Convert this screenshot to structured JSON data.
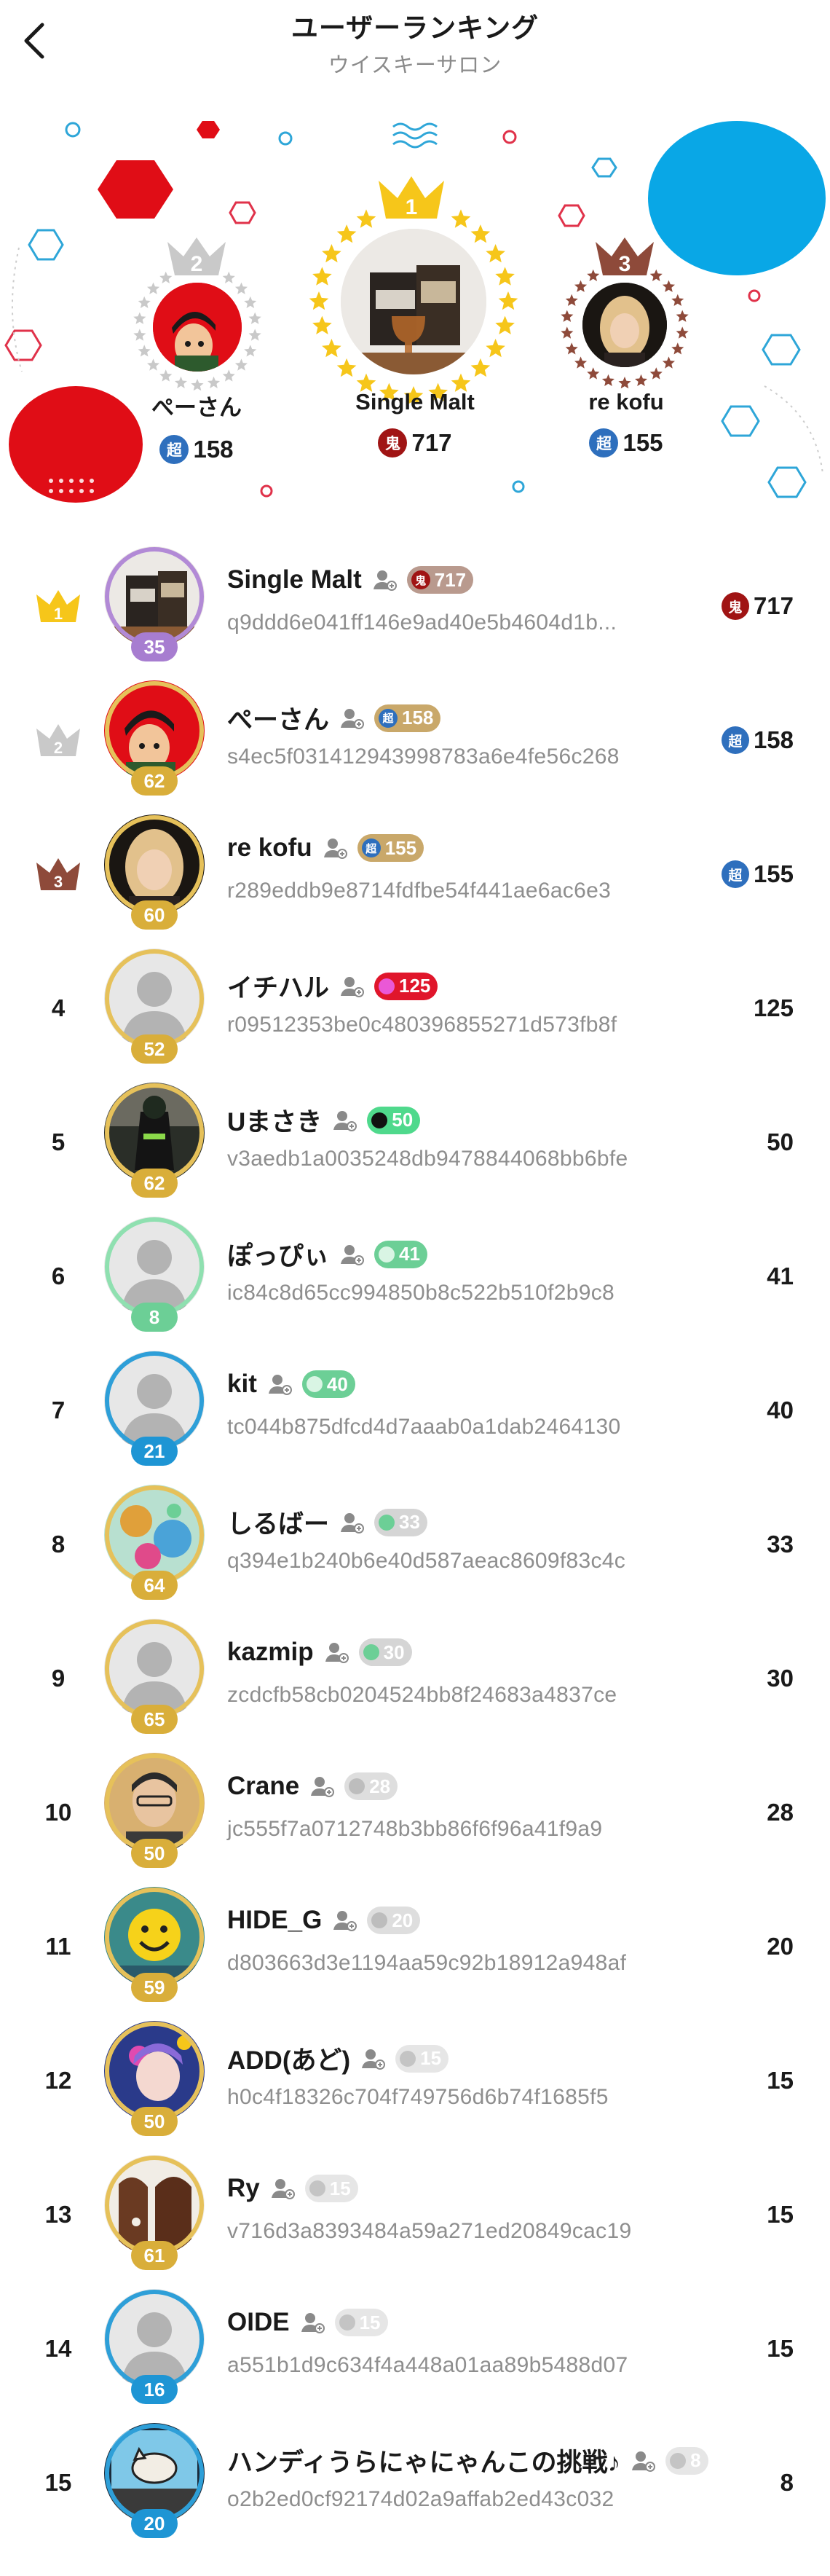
{
  "header": {
    "title": "ユーザーランキング",
    "subtitle": "ウイスキーサロン"
  },
  "podium": {
    "first": {
      "rank": "1",
      "name": "Single Malt",
      "badge": "鬼",
      "score": "717"
    },
    "second": {
      "rank": "2",
      "name": "ぺーさん",
      "badge": "超",
      "score": "158"
    },
    "third": {
      "rank": "3",
      "name": "re kofu",
      "badge": "超",
      "score": "155"
    }
  },
  "colors": {
    "gold": "#f6c61a",
    "silver": "#c9c9c9",
    "bronze": "#8e4a3a",
    "red_deco": "#e00d16",
    "blue_deco": "#09a7e6",
    "badge_blue": "#2e6fbd",
    "badge_red": "#a01414"
  },
  "ranking": [
    {
      "rank": "1",
      "name": "Single Malt",
      "id": "q9ddd6e041ff146e9ad40e5b4604d1b...",
      "level": "35",
      "pill_badge": "鬼",
      "pill_value": "717",
      "score_badge": "鬼",
      "score": "717",
      "avatar": "whisky-photo",
      "ring": "#b28ad6",
      "level_color": "#a77dd0",
      "pill_color": "#b99a8e"
    },
    {
      "rank": "2",
      "name": "ぺーさん",
      "id": "s4ec5f031412943998783a6e4fe56c268",
      "level": "62",
      "pill_badge": "超",
      "pill_value": "158",
      "score_badge": "超",
      "score": "158",
      "avatar": "lupin-cartoon",
      "ring": "#e6c15a",
      "level_color": "#d9ae3a",
      "pill_color": "#c9a86a"
    },
    {
      "rank": "3",
      "name": "re kofu",
      "id": "r289eddb9e8714fdfbe54f441ae6ac6e3",
      "level": "60",
      "pill_badge": "超",
      "pill_value": "155",
      "score_badge": "超",
      "score": "155",
      "avatar": "person-photo",
      "ring": "#e6c15a",
      "level_color": "#d9ae3a",
      "pill_color": "#c9a86a"
    },
    {
      "rank": "4",
      "name": "イチハル",
      "id": "r09512353be0c480396855271d573fb8f",
      "level": "52",
      "pill_value": "125",
      "score": "125",
      "avatar": "default",
      "ring": "#e6c15a",
      "level_color": "#d9ae3a",
      "pill_color": "#e0162b",
      "dot_color": "#ea58d6"
    },
    {
      "rank": "5",
      "name": "Uまさき",
      "id": "v3aedb1a0035248db9478844068bb6bfe",
      "level": "62",
      "pill_value": "50",
      "score": "50",
      "avatar": "figure-photo",
      "ring": "#e6c15a",
      "level_color": "#d9ae3a",
      "pill_color": "#4fd98c",
      "dot_color": "#111111"
    },
    {
      "rank": "6",
      "name": "ぽっぴぃ",
      "id": "ic84c8d65cc994850b8c522b510f2b9c8",
      "level": "8",
      "pill_value": "41",
      "score": "41",
      "avatar": "default",
      "ring": "#8fe0b0",
      "level_color": "#6ccf96",
      "pill_color": "#6ccf96",
      "dot_color": "#d9f5e4"
    },
    {
      "rank": "7",
      "name": "kit",
      "id": "tc044b875dfcd4d7aaab0a1dab2464130",
      "level": "21",
      "pill_value": "40",
      "score": "40",
      "avatar": "default",
      "ring": "#2e9fd8",
      "level_color": "#1e95d4",
      "pill_color": "#6ccf96",
      "dot_color": "#d9f5e4"
    },
    {
      "rank": "8",
      "name": "しるばー",
      "id": "q394e1b240b6e40d587aeac8609f83c4c",
      "level": "64",
      "pill_value": "33",
      "score": "33",
      "avatar": "colorful-photo",
      "ring": "#e6c15a",
      "level_color": "#d9ae3a",
      "pill_color": "#d5d5d5",
      "dot_color": "#6ccf96"
    },
    {
      "rank": "9",
      "name": "kazmip",
      "id": "zcdcfb58cb0204524bb8f24683a4837ce",
      "level": "65",
      "pill_value": "30",
      "score": "30",
      "avatar": "default",
      "ring": "#e6c15a",
      "level_color": "#d9ae3a",
      "pill_color": "#d5d5d5",
      "dot_color": "#6ccf96"
    },
    {
      "rank": "10",
      "name": "Crane",
      "id": "jc555f7a0712748b3bb86f6f96a41f9a9",
      "level": "50",
      "pill_value": "28",
      "score": "28",
      "avatar": "man-photo",
      "ring": "#e6c15a",
      "level_color": "#d9ae3a",
      "pill_color": "#dedede",
      "dot_color": "#bdbdbd"
    },
    {
      "rank": "11",
      "name": "HIDE_G",
      "id": "d803663d3e1194aa59c92b18912a948af",
      "level": "59",
      "pill_value": "20",
      "score": "20",
      "avatar": "smiley-art",
      "ring": "#e6c15a",
      "level_color": "#d9ae3a",
      "pill_color": "#dedede",
      "dot_color": "#bdbdbd"
    },
    {
      "rank": "12",
      "name": "ADD(あど)",
      "id": "h0c4f18326c704f749756d6b74f1685f5",
      "level": "50",
      "pill_value": "15",
      "score": "15",
      "avatar": "anime-art",
      "ring": "#e6c15a",
      "level_color": "#d9ae3a",
      "pill_color": "#e6e6e6",
      "dot_color": "#c4c4c4"
    },
    {
      "rank": "13",
      "name": "Ry",
      "id": "v716d3a8393484a59a271ed20849cac19",
      "level": "61",
      "pill_value": "15",
      "score": "15",
      "avatar": "brown-photo",
      "ring": "#e6c15a",
      "level_color": "#d9ae3a",
      "pill_color": "#e6e6e6",
      "dot_color": "#c4c4c4"
    },
    {
      "rank": "14",
      "name": "OIDE",
      "id": "a551b1d9c634f4a448a01aa89b5488d07",
      "level": "16",
      "pill_value": "15",
      "score": "15",
      "avatar": "default",
      "ring": "#2e9fd8",
      "level_color": "#1e95d4",
      "pill_color": "#e6e6e6",
      "dot_color": "#c4c4c4"
    },
    {
      "rank": "15",
      "name": "ハンディうらにゃにゃんこの挑戦♪",
      "id": "o2b2ed0cf92174d02a9affab2ed43c032",
      "level": "20",
      "pill_value": "8",
      "score": "8",
      "avatar": "cat-art",
      "ring": "#2e9fd8",
      "level_color": "#1e95d4",
      "pill_color": "#e6e6e6",
      "dot_color": "#c4c4c4"
    }
  ]
}
